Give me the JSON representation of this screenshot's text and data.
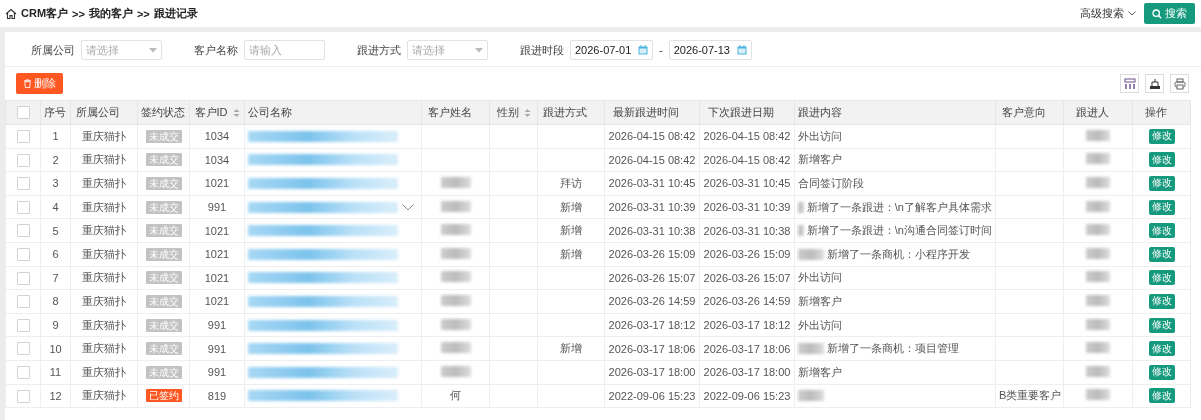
{
  "breadcrumb": [
    "CRM客户",
    "我的客户",
    "跟进记录"
  ],
  "breadcrumb_separator": ">>",
  "top_actions": {
    "advanced": "高级搜索",
    "search": "搜索"
  },
  "filters": [
    {
      "label": "所属公司",
      "kind": "select",
      "placeholder": "请选择"
    },
    {
      "label": "客户名称",
      "kind": "input",
      "placeholder": "请输入"
    },
    {
      "label": "跟进方式",
      "kind": "select",
      "placeholder": "请选择"
    },
    {
      "label": "跟进时段",
      "kind": "daterange",
      "from": "2026-07-01",
      "separator": "-",
      "to": "2026-07-13"
    }
  ],
  "delete_button": "删除",
  "table": {
    "all_checked": false,
    "columns": [
      {
        "label": "序号",
        "sortable": false
      },
      {
        "label": "所属公司",
        "sortable": false
      },
      {
        "label": "签约状态",
        "sortable": false
      },
      {
        "label": "客户ID",
        "sortable": true
      },
      {
        "label": "公司名称",
        "sortable": false
      },
      {
        "label": "客户姓名",
        "sortable": false
      },
      {
        "label": "性别",
        "sortable": true
      },
      {
        "label": "跟进方式",
        "sortable": false
      },
      {
        "label": "最新跟进时间",
        "sortable": false
      },
      {
        "label": "下次跟进日期",
        "sortable": false
      },
      {
        "label": "跟进内容",
        "sortable": false
      },
      {
        "label": "客户意向",
        "sortable": false
      },
      {
        "label": "跟进人",
        "sortable": false
      },
      {
        "label": "操作",
        "sortable": false
      }
    ],
    "rows": [
      {
        "checked": false,
        "no": "1",
        "company": "重庆猫扑",
        "status": "未成交",
        "signed": false,
        "id": "1034",
        "chevron": false,
        "customer_blurred": false,
        "method": "",
        "latest": "2026-04-15 08:42",
        "next": "2026-04-15 08:42",
        "content_blurred": false,
        "content": "外出访问",
        "intent": "",
        "action": "修改"
      },
      {
        "checked": false,
        "no": "2",
        "company": "重庆猫扑",
        "status": "未成交",
        "signed": false,
        "id": "1034",
        "chevron": false,
        "customer_blurred": false,
        "method": "",
        "latest": "2026-04-15 08:42",
        "next": "2026-04-15 08:42",
        "content_blurred": false,
        "content": "新增客户",
        "intent": "",
        "action": "修改"
      },
      {
        "checked": false,
        "no": "3",
        "company": "重庆猫扑",
        "status": "未成交",
        "signed": false,
        "id": "1021",
        "chevron": false,
        "customer_blurred": true,
        "method": "拜访",
        "latest": "2026-03-31 10:45",
        "next": "2026-03-31 10:45",
        "content_blurred": false,
        "content": "合同签订阶段",
        "intent": "",
        "action": "修改"
      },
      {
        "checked": false,
        "no": "4",
        "company": "重庆猫扑",
        "status": "未成交",
        "signed": false,
        "id": "991",
        "chevron": true,
        "customer_blurred": true,
        "method": "新增",
        "latest": "2026-03-31 10:39",
        "next": "2026-03-31 10:39",
        "content_blurred": true,
        "content": "新增了一条跟进：\\n了解客户具体需求",
        "intent": "",
        "action": "修改"
      },
      {
        "checked": false,
        "no": "5",
        "company": "重庆猫扑",
        "status": "未成交",
        "signed": false,
        "id": "1021",
        "chevron": false,
        "customer_blurred": true,
        "method": "新增",
        "latest": "2026-03-31 10:38",
        "next": "2026-03-31 10:38",
        "content_blurred": true,
        "content": "新增了一条跟进：\\n沟通合同签订时间",
        "intent": "",
        "action": "修改"
      },
      {
        "checked": false,
        "no": "6",
        "company": "重庆猫扑",
        "status": "未成交",
        "signed": false,
        "id": "1021",
        "chevron": false,
        "customer_blurred": true,
        "method": "新增",
        "latest": "2026-03-26 15:09",
        "next": "2026-03-26 15:09",
        "content_blurred": true,
        "content": "新增了一条商机：小程序开发",
        "intent": "",
        "action": "修改"
      },
      {
        "checked": false,
        "no": "7",
        "company": "重庆猫扑",
        "status": "未成交",
        "signed": false,
        "id": "1021",
        "chevron": false,
        "customer_blurred": true,
        "method": "",
        "latest": "2026-03-26 15:07",
        "next": "2026-03-26 15:07",
        "content_blurred": false,
        "content": "外出访问",
        "intent": "",
        "action": "修改"
      },
      {
        "checked": false,
        "no": "8",
        "company": "重庆猫扑",
        "status": "未成交",
        "signed": false,
        "id": "1021",
        "chevron": false,
        "customer_blurred": true,
        "method": "",
        "latest": "2026-03-26 14:59",
        "next": "2026-03-26 14:59",
        "content_blurred": false,
        "content": "新增客户",
        "intent": "",
        "action": "修改"
      },
      {
        "checked": false,
        "no": "9",
        "company": "重庆猫扑",
        "status": "未成交",
        "signed": false,
        "id": "991",
        "chevron": false,
        "customer_blurred": true,
        "method": "",
        "latest": "2026-03-17 18:12",
        "next": "2026-03-17 18:12",
        "content_blurred": false,
        "content": "外出访问",
        "intent": "",
        "action": "修改"
      },
      {
        "checked": false,
        "no": "10",
        "company": "重庆猫扑",
        "status": "未成交",
        "signed": false,
        "id": "991",
        "chevron": false,
        "customer_blurred": true,
        "method": "新增",
        "latest": "2026-03-17 18:06",
        "next": "2026-03-17 18:06",
        "content_blurred": true,
        "content": "新增了一条商机：项目管理",
        "intent": "",
        "action": "修改"
      },
      {
        "checked": false,
        "no": "11",
        "company": "重庆猫扑",
        "status": "未成交",
        "signed": false,
        "id": "991",
        "chevron": false,
        "customer_blurred": true,
        "method": "",
        "latest": "2026-03-17 18:00",
        "next": "2026-03-17 18:00",
        "content_blurred": false,
        "content": "新增客户",
        "intent": "",
        "action": "修改"
      },
      {
        "checked": false,
        "no": "12",
        "company": "重庆猫扑",
        "status": "已签约",
        "signed": true,
        "id": "819",
        "chevron": false,
        "customer_blurred": false,
        "customer": "何",
        "method": "",
        "latest": "2022-09-06 15:23",
        "next": "2022-09-06 15:23",
        "content_blurred": true,
        "content": "",
        "intent": "B类重要客户",
        "action": "修改"
      }
    ]
  }
}
